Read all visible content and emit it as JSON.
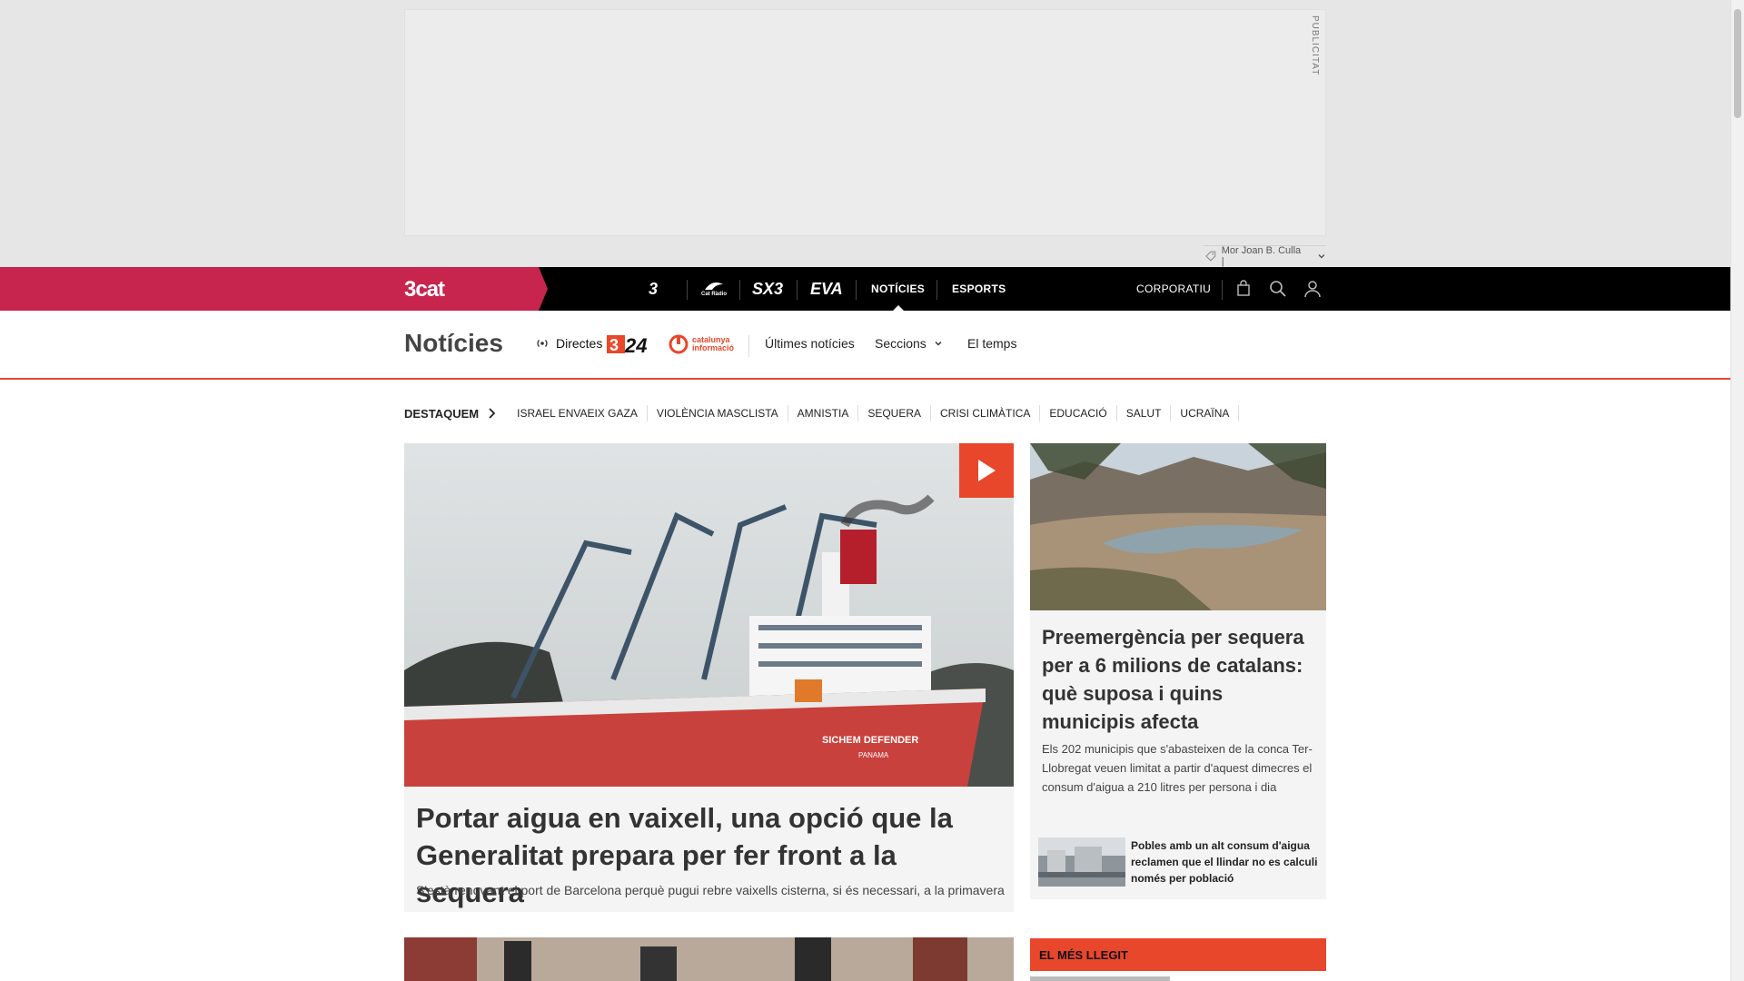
{
  "ad": {
    "label": "PUBLICITAT",
    "tag_text": "Mor Joan B. Culla |"
  },
  "topnav": {
    "brand": "3cat",
    "channels": [
      "3",
      "Cat Ràdio",
      "SX3",
      "EVA"
    ],
    "links": [
      {
        "label": "NOTÍCIES",
        "active": true
      },
      {
        "label": "ESPORTS",
        "active": false
      }
    ],
    "corporate": "CORPORATIU",
    "icons": [
      "shopping-bag-icon",
      "search-icon",
      "user-icon"
    ]
  },
  "section": {
    "title": "Notícies",
    "live_label": "Directes",
    "logo_324": "324",
    "logo_ci_line1": "catalunya",
    "logo_ci_line2": "informació",
    "links": {
      "ultimes": "Últimes notícies",
      "seccions": "Seccions",
      "temps": "El temps"
    }
  },
  "destaquem": {
    "label": "DESTAQUEM",
    "tags": [
      "ISRAEL ENVAEIX GAZA",
      "VIOLÈNCIA MASCLISTA",
      "AMNISTIA",
      "SEQUERA",
      "CRISI CLIMÀTICA",
      "EDUCACIÓ",
      "SALUT",
      "UCRAÏNA"
    ]
  },
  "main_article": {
    "title": "Portar aigua en vaixell, una opció que la Generalitat prepara per fer front a la sequera",
    "subtitle": "S'està renovant el port de Barcelona perquè pugui rebre vaixells cisterna, si és necessari, a la primavera",
    "image_caption_ship": "SICHEM DEFENDER",
    "image_caption_port": "PANAMA"
  },
  "side_article": {
    "title": "Preemergència per sequera per a 6 milions de catalans: què suposa i quins municipis afecta",
    "subtitle": "Els 202 municipis que s'abasteixen de la conca Ter-Llobregat veuen limitat a partir d'aquest dimecres el consum d'aigua a 210 litres per persona i dia",
    "related": "Pobles amb un alt consum d'aigua reclamen que el llindar no es calculi només per població"
  },
  "most_read": {
    "label": "EL MÉS LLEGIT"
  },
  "colors": {
    "brand": "#c7254e",
    "accent": "#e8472c",
    "nav_bg": "#000000"
  }
}
